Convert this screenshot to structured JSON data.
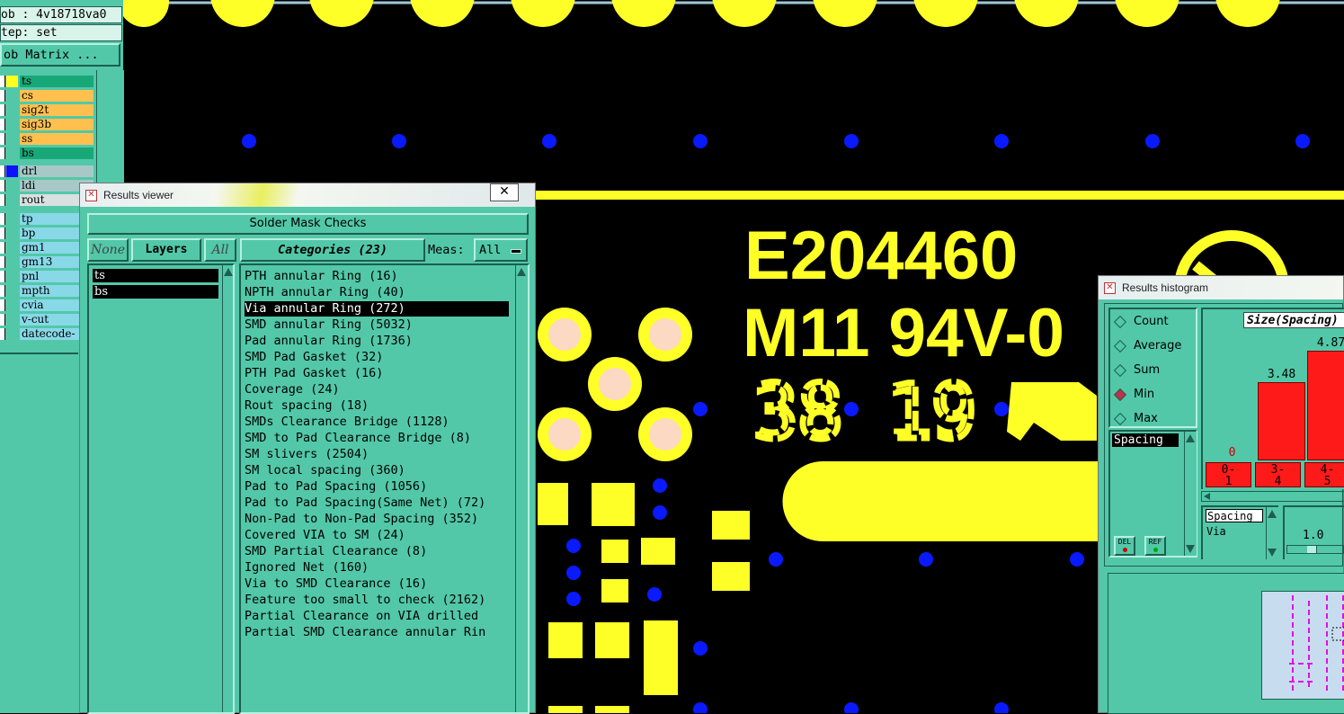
{
  "left_panel": {
    "job_field": "ob : 4v18718va0",
    "step_field": "tep: set",
    "job_matrix_button": "ob Matrix ...",
    "layers": [
      {
        "name": "ts",
        "color": "#18a878",
        "swatch": "#ffff20"
      },
      {
        "name": "cs",
        "color": "#ffc050",
        "swatch": "#52c8a8"
      },
      {
        "name": "sig2t",
        "color": "#ffc050",
        "swatch": "#52c8a8"
      },
      {
        "name": "sig3b",
        "color": "#ffc050",
        "swatch": "#52c8a8"
      },
      {
        "name": "ss",
        "color": "#ffc050",
        "swatch": "#52c8a8"
      },
      {
        "name": "bs",
        "color": "#18a878",
        "swatch": "#52c8a8"
      },
      {
        "name": "drl",
        "color": "#a8c8c8",
        "swatch": "#1010ff"
      },
      {
        "name": "ldi",
        "color": "#a8c8c8",
        "swatch": "#52c8a8"
      },
      {
        "name": "rout",
        "color": "#d8e0e0",
        "swatch": "#52c8a8"
      },
      {
        "name": "tp",
        "color": "#88d8e8",
        "swatch": "#52c8a8"
      },
      {
        "name": "bp",
        "color": "#88d8e8",
        "swatch": "#52c8a8"
      },
      {
        "name": "gm1",
        "color": "#88d8e8",
        "swatch": "#52c8a8"
      },
      {
        "name": "gm13",
        "color": "#88d8e8",
        "swatch": "#52c8a8"
      },
      {
        "name": "pnl",
        "color": "#88d8e8",
        "swatch": "#52c8a8"
      },
      {
        "name": "mpth",
        "color": "#88d8e8",
        "swatch": "#52c8a8"
      },
      {
        "name": "cvia",
        "color": "#88d8e8",
        "swatch": "#52c8a8"
      },
      {
        "name": "v-cut",
        "color": "#88d8e8",
        "swatch": "#52c8a8"
      },
      {
        "name": "datecode-",
        "color": "#88d8e8",
        "swatch": "#52c8a8"
      }
    ]
  },
  "board": {
    "line1": "E204460",
    "line2": "M11 94V-0",
    "line3": "38 19"
  },
  "results_viewer": {
    "title": "Results viewer",
    "close_label": "✕",
    "check_title": "Solder Mask Checks",
    "none_button": "None",
    "layers_button": "Layers",
    "all_button": "All",
    "categories_button": "Categories (23)",
    "meas_label": "Meas:",
    "meas_value": "All",
    "layer_list": [
      "ts",
      "bs"
    ],
    "selected_category": 2,
    "categories": [
      "PTH annular Ring (16)",
      "NPTH annular Ring (40)",
      "Via annular Ring (272)",
      "SMD annular Ring (5032)",
      "Pad annular Ring (1736)",
      "SMD Pad Gasket (32)",
      "PTH Pad Gasket (16)",
      "Coverage (24)",
      "Rout spacing (18)",
      "SMDs Clearance Bridge (1128)",
      "SMD to Pad Clearance Bridge (8)",
      "SM slivers (2504)",
      "SM local spacing (360)",
      "Pad to Pad Spacing (1056)",
      "Pad to Pad Spacing(Same Net) (72)",
      "Non-Pad to Non-Pad Spacing (352)",
      "Covered VIA to SM (24)",
      "SMD Partial Clearance (8)",
      "Ignored Net (160)",
      "Via to SMD Clearance (16)",
      "Feature too small to check (2162)",
      "Partial Clearance on VIA drilled",
      "Partial SMD Clearance annular Rin"
    ]
  },
  "results_histogram": {
    "title": "Results histogram",
    "options": [
      "Count",
      "Average",
      "Sum",
      "Min",
      "Max"
    ],
    "selected_option": "Min",
    "list_item": "Spacing",
    "del_button": "DEL",
    "ref_button": "REF",
    "chart_title": "Size(Spacing)",
    "detail_line1": "Spacing",
    "detail_line2": "Via",
    "slider_value": "1.0"
  },
  "chart_data": {
    "type": "bar",
    "title": "Size(Spacing)",
    "categories": [
      "0-1",
      "3-4",
      "4-5"
    ],
    "category_labels": [
      [
        "0-",
        "1"
      ],
      [
        "3-",
        "4"
      ],
      [
        "4-",
        "5"
      ]
    ],
    "values": [
      0,
      3.48,
      4.87
    ],
    "value_labels": [
      "0",
      "3.48",
      "4.87"
    ],
    "ylim": [
      0,
      5.6
    ],
    "bar_color": "#ff1a1a"
  }
}
